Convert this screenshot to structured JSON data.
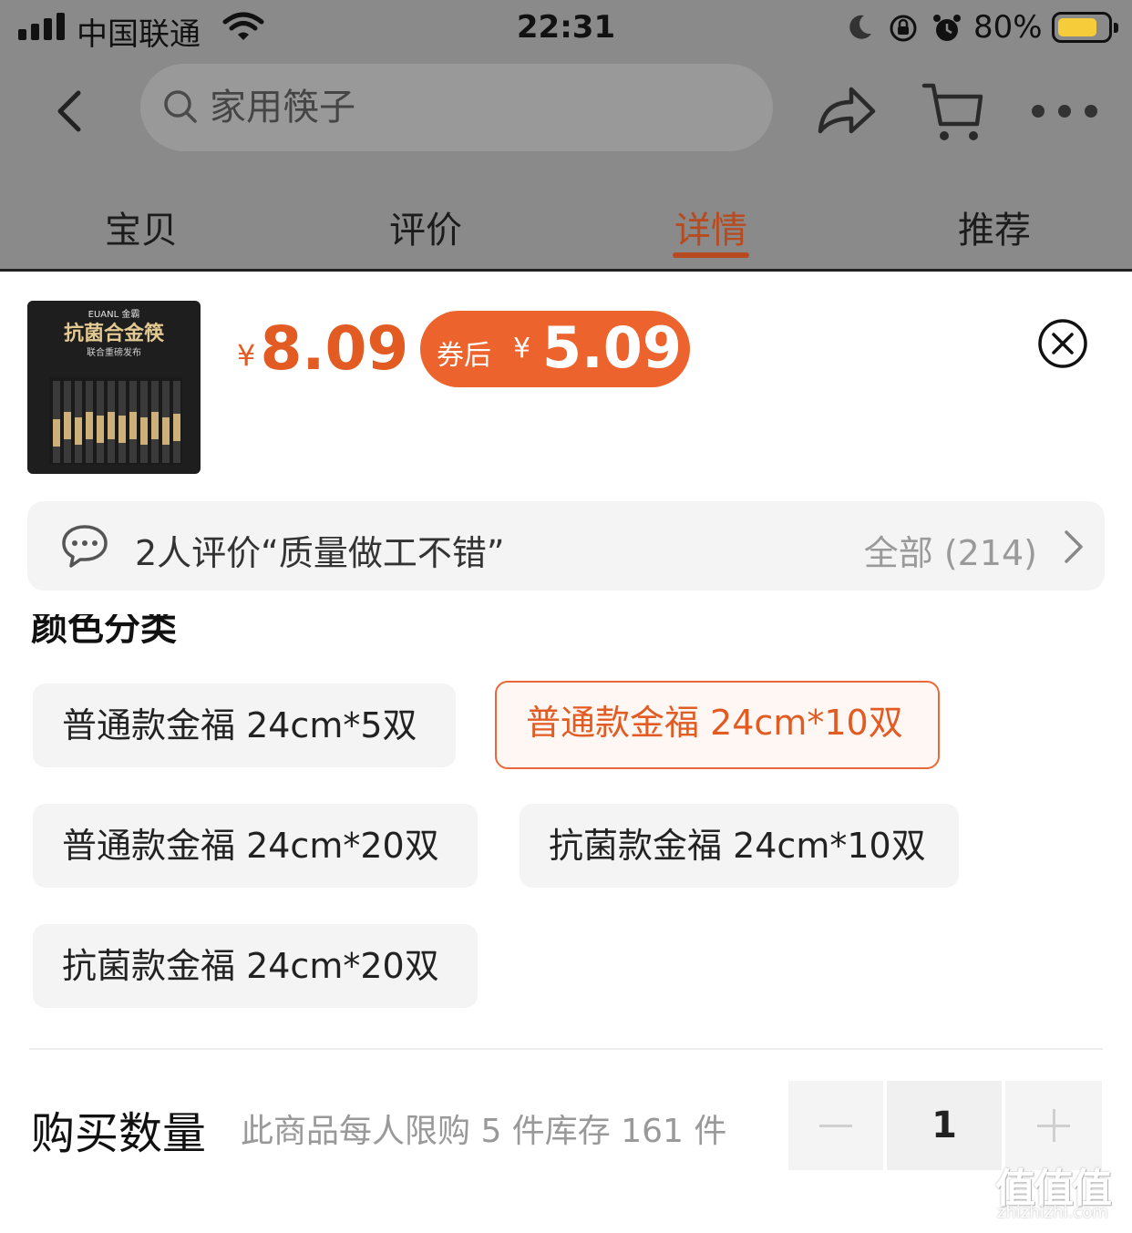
{
  "status_bar": {
    "carrier": "中国联通",
    "time": "22:31",
    "battery_percent": "80%",
    "battery_level": 0.8
  },
  "nav": {
    "search_placeholder": "家用筷子",
    "icons": [
      "back-icon",
      "search-icon",
      "share-icon",
      "cart-icon",
      "more-icon"
    ]
  },
  "tabs": [
    {
      "label": "宝贝",
      "active": false
    },
    {
      "label": "评价",
      "active": false
    },
    {
      "label": "详情",
      "active": true
    },
    {
      "label": "推荐",
      "active": false
    }
  ],
  "product": {
    "thumb": {
      "brand": "EUANL 金霸",
      "title": "抗菌合金筷",
      "subtitle": "联合重磅发布"
    },
    "price_symbol": "¥",
    "price": "8.09",
    "coupon_label": "券后",
    "coupon_symbol": "¥",
    "coupon_price": "5.09"
  },
  "review": {
    "summary": "2人评价“质量做工不错”",
    "all_label": "全部 (214)"
  },
  "sku": {
    "section_title": "颜色分类",
    "options": [
      {
        "label": "普通款金福 24cm*5双",
        "selected": false
      },
      {
        "label": "普通款金福 24cm*10双",
        "selected": true
      },
      {
        "label": "普通款金福 24cm*20双",
        "selected": false
      },
      {
        "label": "抗菌款金福 24cm*10双",
        "selected": false
      },
      {
        "label": "抗菌款金福 24cm*20双",
        "selected": false
      }
    ]
  },
  "quantity": {
    "label": "购买数量",
    "note": "此商品每人限购 5 件库存 161 件",
    "value": "1"
  },
  "watermark": {
    "glyphs": "值值值",
    "domain": "zhizhizhi.com"
  },
  "colors": {
    "accent": "#e25b22",
    "coupon_bg": "#ec632d",
    "dim_overlay": "#8a8a8a",
    "chip_bg": "#f4f4f4",
    "active_tab": "#b84a1f"
  }
}
